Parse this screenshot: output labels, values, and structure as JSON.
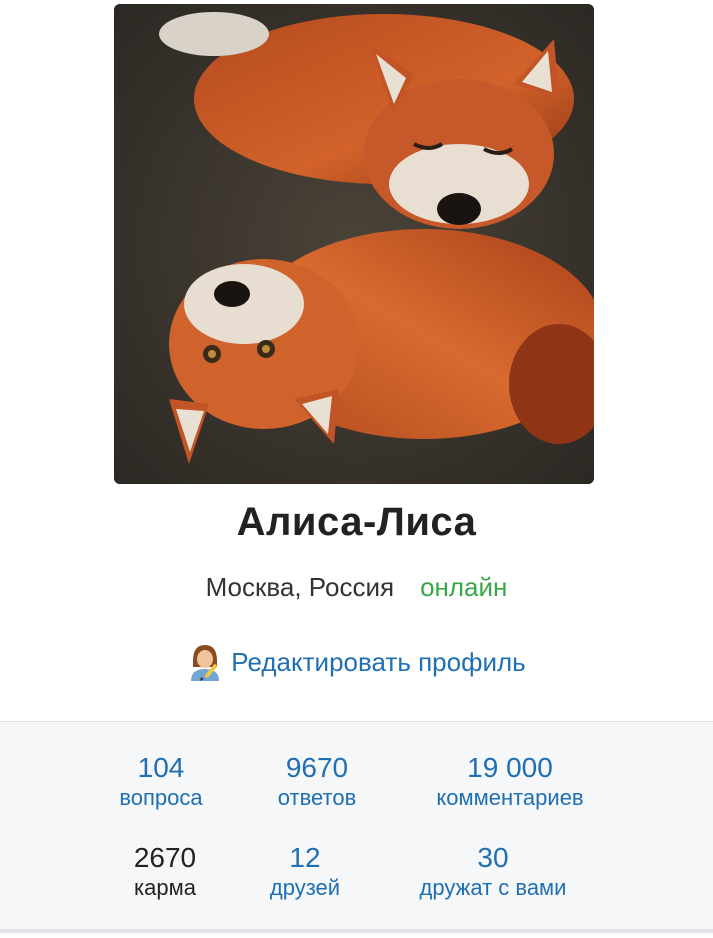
{
  "profile": {
    "name": "Алиса-Лиса",
    "location": "Москва, Россия",
    "status": "онлайн",
    "status_color": "#3aa648",
    "edit_label": "Редактировать профиль",
    "edit_icon": "woman-with-pencil-icon",
    "photo": "fox-photo"
  },
  "stats": [
    {
      "value": "104",
      "label": "вопроса"
    },
    {
      "value": "9670",
      "label": "ответов"
    },
    {
      "value": "19 000",
      "label": "комментариев"
    },
    {
      "value": "2670",
      "label": "карма"
    },
    {
      "value": "12",
      "label": "друзей"
    },
    {
      "value": "30",
      "label": "дружат с вами"
    }
  ],
  "colors": {
    "link": "#1f6fb2",
    "panel_bg": "#f5f7f9"
  }
}
